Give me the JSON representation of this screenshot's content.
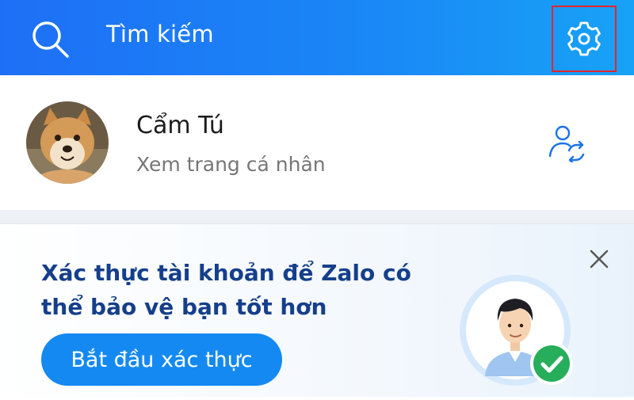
{
  "header": {
    "search_placeholder": "Tìm kiếm",
    "search_icon": "search-icon",
    "settings_icon": "gear-icon"
  },
  "profile": {
    "name": "Cẩm Tú",
    "subtitle": "Xem trang cá nhân",
    "switch_icon": "switch-account-icon"
  },
  "banner": {
    "title": "Xác thực tài khoản để Zalo có thể bảo vệ bạn tốt hơn",
    "cta_label": "Bắt đầu xác thực",
    "close_icon": "close-icon"
  },
  "colors": {
    "header_start": "#1e6ff5",
    "header_end": "#18a2f6",
    "highlight_border": "#e3262b",
    "banner_title": "#153f8a",
    "cta": "#1489f2",
    "check_badge": "#27ae5b"
  }
}
